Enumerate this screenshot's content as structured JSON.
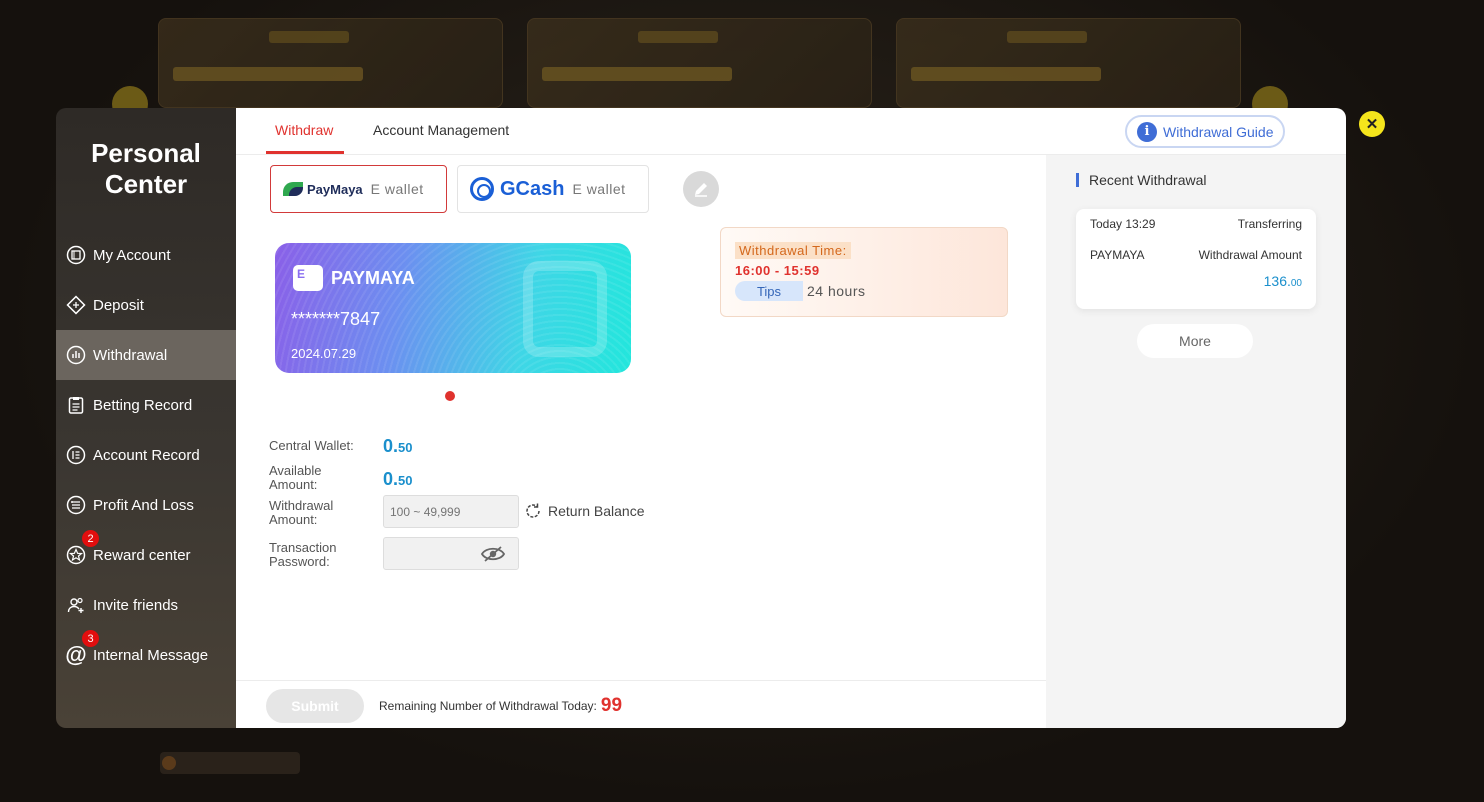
{
  "sidebar": {
    "title_line1": "Personal",
    "title_line2": "Center",
    "items": [
      {
        "label": "My Account"
      },
      {
        "label": "Deposit"
      },
      {
        "label": "Withdrawal"
      },
      {
        "label": "Betting Record"
      },
      {
        "label": "Account Record"
      },
      {
        "label": "Profit And Loss"
      },
      {
        "label": "Reward center",
        "badge": "2"
      },
      {
        "label": "Invite friends"
      },
      {
        "label": "Internal Message",
        "badge": "3"
      }
    ]
  },
  "tabs": {
    "withdraw": "Withdraw",
    "account_management": "Account Management",
    "guide": "Withdrawal Guide"
  },
  "wallets": {
    "paymaya": {
      "brand": "PayMaya",
      "sub": "E wallet"
    },
    "gcash": {
      "brand": "GCash",
      "sub": "E wallet"
    }
  },
  "card": {
    "icon_letter": "E",
    "name": "PAYMAYA",
    "number": "*******7847",
    "date": "2024.07.29"
  },
  "time_box": {
    "label": "Withdrawal Time:",
    "time": "16:00  - 15:59",
    "tips_label": "Tips",
    "hours": "24 hours"
  },
  "form": {
    "central_wallet_label": "Central Wallet:",
    "central_wallet_int": "0.",
    "central_wallet_dec": "50",
    "available_label_1": "Available",
    "available_label_2": "Amount:",
    "available_int": "0.",
    "available_dec": "50",
    "withdrawal_label_1": "Withdrawal",
    "withdrawal_label_2": "Amount:",
    "withdrawal_placeholder": "100 ~ 49,999",
    "return_balance": "Return Balance",
    "password_label_1": "Transaction",
    "password_label_2": "Password:"
  },
  "footer": {
    "submit": "Submit",
    "remaining_label": "Remaining Number of Withdrawal Today:",
    "remaining_count": "99"
  },
  "recent": {
    "title": "Recent Withdrawal",
    "date": "Today 13:29",
    "status": "Transferring",
    "method": "PAYMAYA",
    "amount_label": "Withdrawal Amount",
    "amount_int": "136.",
    "amount_dec": "00",
    "more": "More"
  },
  "colors": {
    "accent_red": "#e0322e",
    "accent_blue": "#3f6dd6",
    "amount_blue": "#1a8fcc",
    "close_yellow": "#f5e51c"
  }
}
